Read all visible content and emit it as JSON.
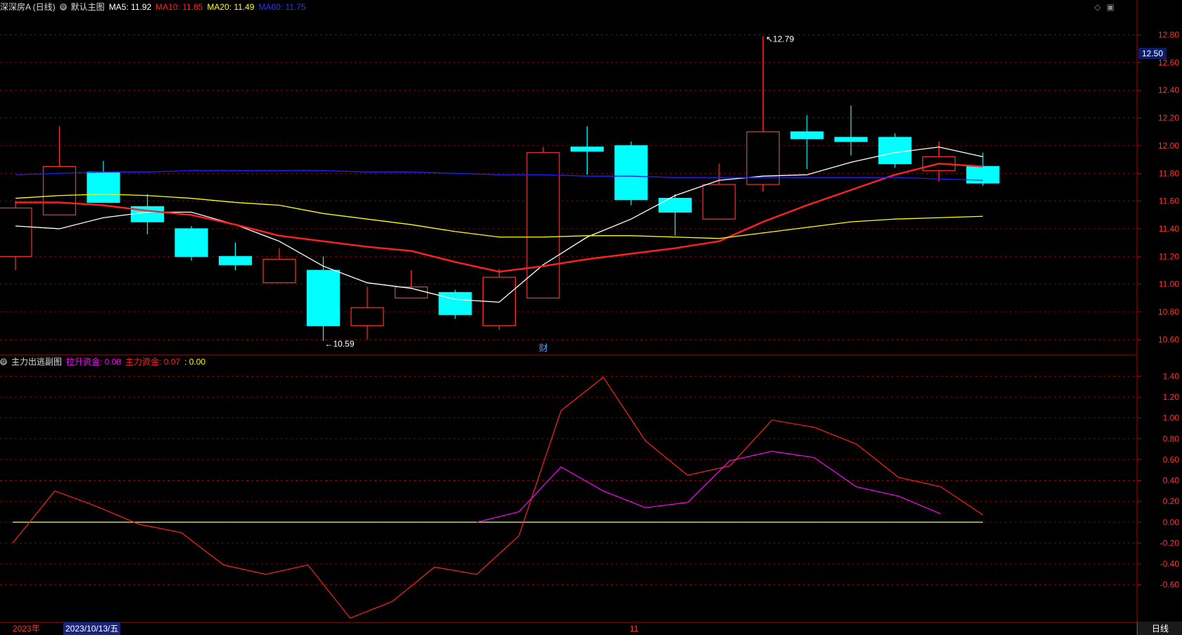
{
  "header": {
    "stock_name": "深深房A (日线)",
    "main_label": "默认主图",
    "ma": [
      {
        "label": "MA5: 11.92",
        "color": "#ffffff"
      },
      {
        "label": "MA10: 11.85",
        "color": "#ff2020"
      },
      {
        "label": "MA20: 11.49",
        "color": "#ffff00"
      },
      {
        "label": "MA60: 11.75",
        "color": "#2020ff"
      }
    ]
  },
  "sub_header": {
    "title": "主力出逃副图",
    "items": [
      {
        "label": "拉升资金: 0.08",
        "color": "#ff00ff"
      },
      {
        "label": "主力资金: 0.07",
        "color": "#ff2020"
      },
      {
        "label": ": 0.00",
        "color": "#ffff00"
      }
    ]
  },
  "price_tag": "12.50",
  "period_button": "日线",
  "date_axis": {
    "year": "2023年",
    "date": "2023/10/13/五",
    "month": "11"
  },
  "annotations": {
    "high": "12.79",
    "low": "10.59",
    "finance": "财"
  },
  "colors": {
    "up": "#ff3030",
    "down": "#00ffff",
    "ma5": "#ffffff",
    "ma10": "#ff2020",
    "ma20": "#ffff00",
    "ma60": "#2020ff",
    "lift": "#ff00ff",
    "main": "#ff2020",
    "zero": "#ffff00",
    "grid": "#8b0000"
  },
  "chart_data": [
    {
      "type": "candlestick",
      "y_ticks": [
        "12.80",
        "12.60",
        "12.40",
        "12.20",
        "12.00",
        "11.80",
        "11.60",
        "11.40",
        "11.20",
        "11.00",
        "10.80",
        "10.60"
      ],
      "ylim": [
        10.49,
        12.95
      ],
      "candles": [
        {
          "o": 11.2,
          "c": 11.55,
          "h": 11.6,
          "l": 11.1
        },
        {
          "o": 11.5,
          "c": 11.85,
          "h": 12.14,
          "l": 11.5
        },
        {
          "o": 11.81,
          "c": 11.59,
          "h": 11.89,
          "l": 11.59
        },
        {
          "o": 11.56,
          "c": 11.45,
          "h": 11.65,
          "l": 11.36
        },
        {
          "o": 11.4,
          "c": 11.2,
          "h": 11.42,
          "l": 11.17
        },
        {
          "o": 11.2,
          "c": 11.14,
          "h": 11.3,
          "l": 11.1
        },
        {
          "o": 11.01,
          "c": 11.18,
          "h": 11.26,
          "l": 11.01
        },
        {
          "o": 11.1,
          "c": 10.7,
          "h": 11.2,
          "l": 10.59
        },
        {
          "o": 10.7,
          "c": 10.83,
          "h": 10.98,
          "l": 10.6
        },
        {
          "o": 10.9,
          "c": 10.98,
          "h": 11.1,
          "l": 10.9
        },
        {
          "o": 10.94,
          "c": 10.78,
          "h": 10.96,
          "l": 10.75
        },
        {
          "o": 10.7,
          "c": 11.05,
          "h": 11.11,
          "l": 10.67
        },
        {
          "o": 10.9,
          "c": 11.95,
          "h": 11.99,
          "l": 10.9
        },
        {
          "o": 11.99,
          "c": 11.96,
          "h": 12.14,
          "l": 11.79
        },
        {
          "o": 12.0,
          "c": 11.61,
          "h": 12.03,
          "l": 11.57
        },
        {
          "o": 11.62,
          "c": 11.52,
          "h": 11.65,
          "l": 11.35
        },
        {
          "o": 11.47,
          "c": 11.72,
          "h": 11.87,
          "l": 11.47
        },
        {
          "o": 11.72,
          "c": 12.1,
          "h": 12.79,
          "l": 11.67
        },
        {
          "o": 12.1,
          "c": 12.05,
          "h": 12.22,
          "l": 11.83
        },
        {
          "o": 12.06,
          "c": 12.03,
          "h": 12.29,
          "l": 11.93
        },
        {
          "o": 12.06,
          "c": 11.87,
          "h": 12.09,
          "l": 11.84
        },
        {
          "o": 11.82,
          "c": 11.92,
          "h": 12.03,
          "l": 11.74
        },
        {
          "o": 11.85,
          "c": 11.73,
          "h": 11.95,
          "l": 11.71
        }
      ],
      "series": [
        {
          "name": "MA5",
          "values": [
            11.42,
            11.4,
            11.48,
            11.52,
            11.52,
            11.43,
            11.31,
            11.13,
            11.01,
            10.97,
            10.89,
            10.87,
            11.14,
            11.34,
            11.47,
            11.64,
            11.75,
            11.78,
            11.79,
            11.88,
            11.95,
            11.99,
            11.92
          ]
        },
        {
          "name": "MA10",
          "values": [
            11.59,
            11.59,
            11.57,
            11.53,
            11.5,
            11.43,
            11.35,
            11.31,
            11.27,
            11.24,
            11.16,
            11.09,
            11.13,
            11.18,
            11.22,
            11.26,
            11.31,
            11.45,
            11.57,
            11.68,
            11.79,
            11.87,
            11.85
          ]
        },
        {
          "name": "MA20",
          "values": [
            11.62,
            11.64,
            11.65,
            11.64,
            11.62,
            11.59,
            11.57,
            11.51,
            11.47,
            11.43,
            11.38,
            11.34,
            11.34,
            11.35,
            11.35,
            11.34,
            11.33,
            11.37,
            11.41,
            11.45,
            11.47,
            11.48,
            11.49
          ]
        },
        {
          "name": "MA60",
          "values": [
            11.79,
            11.8,
            11.81,
            11.81,
            11.82,
            11.82,
            11.82,
            11.82,
            11.81,
            11.81,
            11.8,
            11.79,
            11.79,
            11.78,
            11.78,
            11.77,
            11.77,
            11.77,
            11.77,
            11.77,
            11.77,
            11.76,
            11.75
          ]
        }
      ]
    },
    {
      "type": "line",
      "y_ticks": [
        "1.40",
        "1.20",
        "1.00",
        "0.80",
        "0.60",
        "0.40",
        "0.20",
        "0.00",
        "-0.20",
        "-0.40",
        "-0.60"
      ],
      "ylim": [
        -0.96,
        1.47
      ],
      "series": [
        {
          "name": "拉升资金",
          "start": 11,
          "values": [
            0.0,
            0.1,
            0.53,
            0.3,
            0.14,
            0.19,
            0.59,
            0.68,
            0.62,
            0.34,
            0.25,
            0.08
          ]
        },
        {
          "name": "主力资金",
          "values": [
            -0.2,
            0.3,
            0.15,
            -0.02,
            -0.1,
            -0.41,
            -0.5,
            -0.41,
            -0.92,
            -0.76,
            -0.43,
            -0.5,
            -0.13,
            1.07,
            1.39,
            0.78,
            0.45,
            0.54,
            0.98,
            0.91,
            0.75,
            0.43,
            0.34,
            0.07
          ]
        },
        {
          "name": "零轴",
          "values": [
            0.0,
            0.0
          ]
        }
      ]
    }
  ]
}
